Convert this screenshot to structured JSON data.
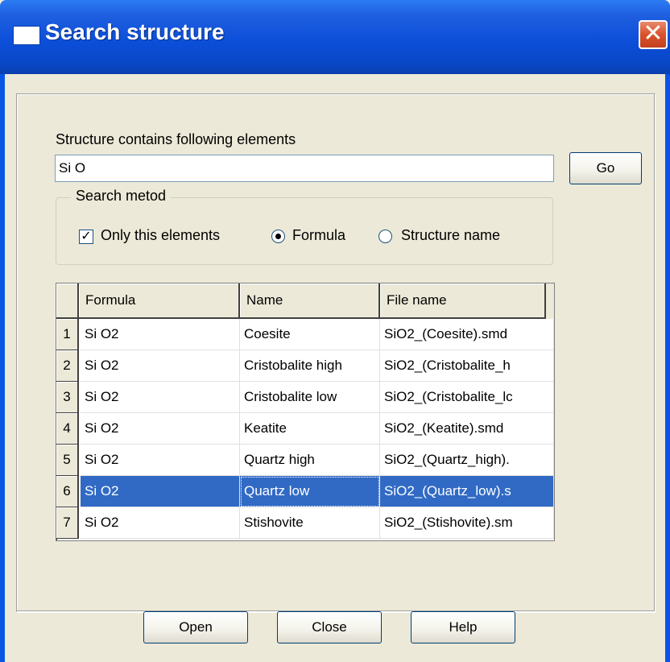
{
  "window": {
    "title": "Search structure",
    "close_glyph": "✕"
  },
  "search": {
    "label": "Structure contains following elements",
    "value": "Si O",
    "go_label": "Go"
  },
  "method": {
    "legend": "Search metod",
    "only_elements_label": "Only this elements",
    "only_elements_checked": true,
    "formula_label": "Formula",
    "structure_name_label": "Structure name",
    "selected": "Formula"
  },
  "grid": {
    "columns": [
      "Formula",
      "Name",
      "File name"
    ],
    "rows": [
      {
        "num": "1",
        "formula": "Si O2",
        "name": "Coesite",
        "file": "SiO2_(Coesite).smd"
      },
      {
        "num": "2",
        "formula": "Si O2",
        "name": "Cristobalite high",
        "file": "SiO2_(Cristobalite_h"
      },
      {
        "num": "3",
        "formula": "Si O2",
        "name": "Cristobalite low",
        "file": "SiO2_(Cristobalite_lc"
      },
      {
        "num": "4",
        "formula": "Si O2",
        "name": "Keatite",
        "file": "SiO2_(Keatite).smd"
      },
      {
        "num": "5",
        "formula": "Si O2",
        "name": "Quartz high",
        "file": "SiO2_(Quartz_high)."
      },
      {
        "num": "6",
        "formula": "Si O2",
        "name": "Quartz low",
        "file": "SiO2_(Quartz_low).s"
      },
      {
        "num": "7",
        "formula": "Si O2",
        "name": "Stishovite",
        "file": "SiO2_(Stishovite).sm"
      }
    ],
    "selected_row": "6"
  },
  "buttons": {
    "open": "Open",
    "close": "Close",
    "help": "Help"
  },
  "colors": {
    "title_bar": "#0a55e4",
    "selection": "#316ac5",
    "face": "#ece9d8"
  }
}
